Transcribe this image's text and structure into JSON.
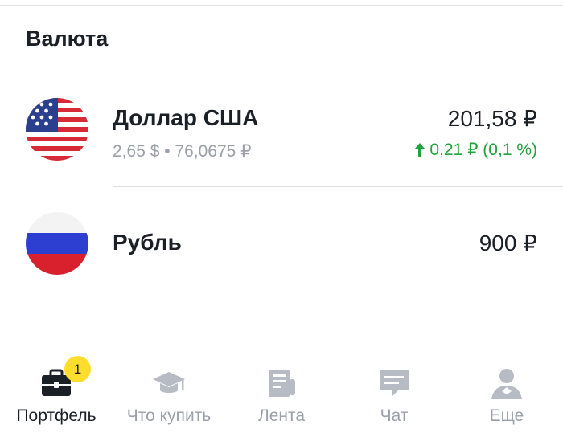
{
  "section": {
    "title": "Валюта"
  },
  "currencies": [
    {
      "name": "Доллар США",
      "sub": "2,65 $ • 76,0675 ₽",
      "amount": "201,58 ₽",
      "change": "0,21 ₽ (0,1 %)",
      "change_direction": "up",
      "flag_icon": "us-flag-icon"
    },
    {
      "name": "Рубль",
      "amount": "900 ₽",
      "flag_icon": "russia-flag-icon"
    }
  ],
  "tabbar": {
    "active_index": 0,
    "items": [
      {
        "label": "Портфель",
        "icon": "briefcase-icon",
        "badge": "1"
      },
      {
        "label": "Что купить",
        "icon": "graduation-cap-icon"
      },
      {
        "label": "Лента",
        "icon": "newspaper-icon"
      },
      {
        "label": "Чат",
        "icon": "chat-icon"
      },
      {
        "label": "Еще",
        "icon": "profile-icon"
      }
    ]
  },
  "colors": {
    "positive": "#1fa33a",
    "secondary_text": "#9aa0a8",
    "primary_text": "#1b1f26",
    "badge": "#ffdd2d",
    "inactive_icon": "#b7bcc4"
  }
}
